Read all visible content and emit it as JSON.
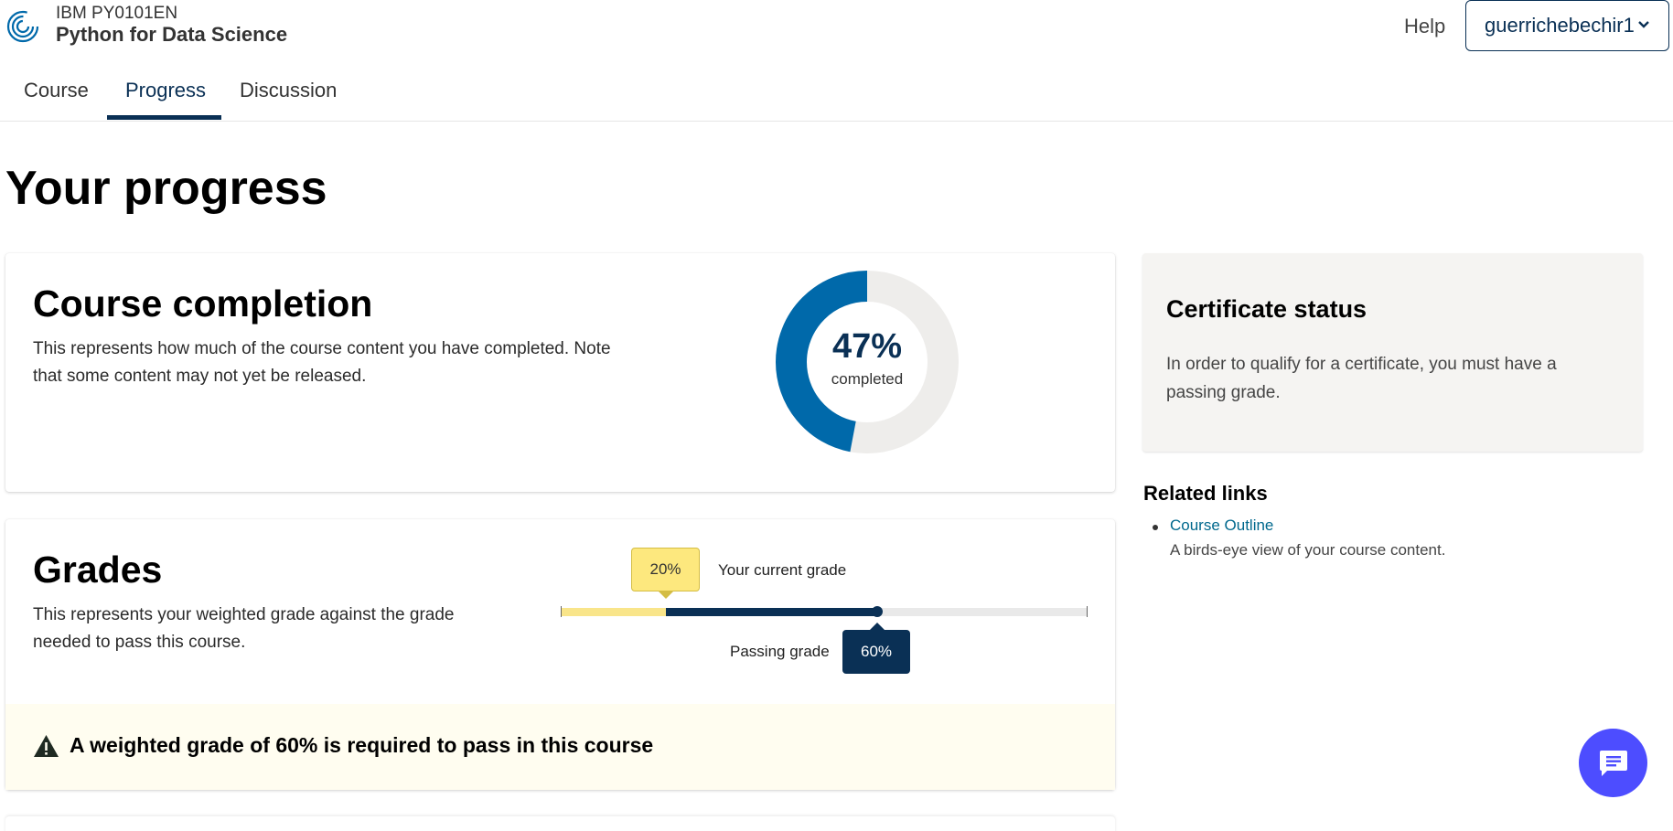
{
  "header": {
    "course_org": "IBM PY0101EN",
    "course_title": "Python for Data Science",
    "help_label": "Help",
    "username": "guerrichebechir1",
    "logo_icon": "spiral-logo-icon",
    "user_chevron": "chevron-down-icon"
  },
  "tabs": [
    {
      "label": "Course"
    },
    {
      "label": "Progress",
      "active": true
    },
    {
      "label": "Discussion"
    }
  ],
  "page_title": "Your progress",
  "completion": {
    "title": "Course completion",
    "description_line1": "This represents how much of the course content you have completed. Note",
    "description_line2": "that some content may not yet be released.",
    "percent": 47,
    "percent_label": "47%",
    "completed_label": "completed",
    "colors": {
      "completed": "#0069aa",
      "remaining": "#eeedeb"
    }
  },
  "grades": {
    "title": "Grades",
    "description_line1": "This represents your weighted grade against the grade",
    "description_line2": "needed to pass this course.",
    "current_grade": 20,
    "current_grade_label": "20%",
    "current_grade_caption": "Your current grade",
    "passing_grade": 60,
    "passing_grade_label": "60%",
    "passing_grade_caption": "Passing grade",
    "warning_text": "A weighted grade of 60% is required to pass in this course",
    "warning_icon": "warning-triangle-icon",
    "colors": {
      "current": "#f9e58a",
      "passing": "#0a3055",
      "track": "#e9e9e9"
    }
  },
  "certificate": {
    "title": "Certificate status",
    "text": "In order to qualify for a certificate, you must have a passing grade."
  },
  "related": {
    "title": "Related links",
    "links": [
      {
        "label": "Course Outline",
        "description": "A birds-eye view of your course content."
      }
    ]
  },
  "chat": {
    "icon": "chat-bubble-icon",
    "color": "#4d4dff"
  }
}
